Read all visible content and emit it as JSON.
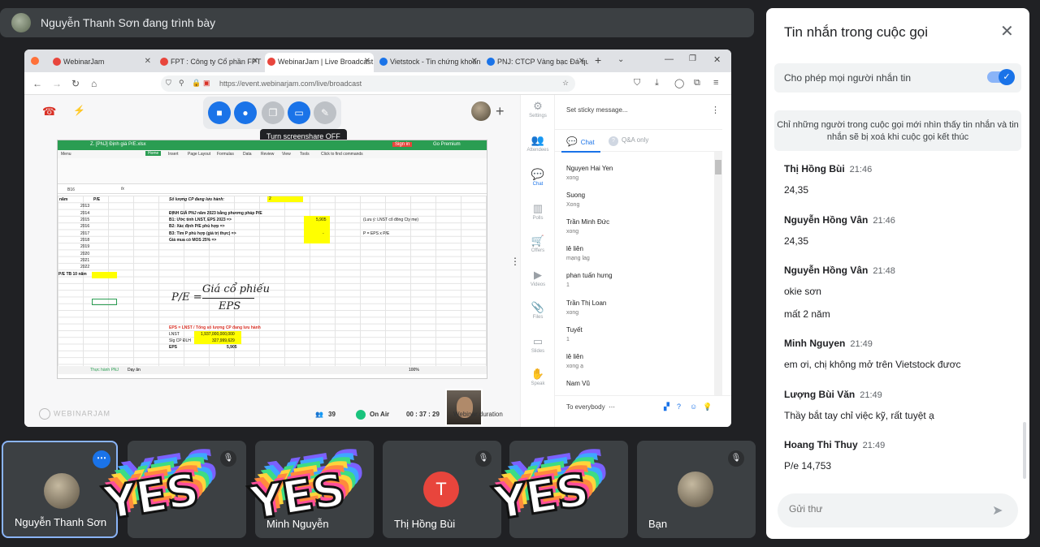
{
  "presenter_bar": {
    "text": "Nguyễn Thanh Sơn đang trình bày"
  },
  "browser": {
    "tabs": [
      {
        "label": "WebinarJam",
        "fav": "#e8453c"
      },
      {
        "label": "FPT : Công ty Cổ phần FPT",
        "fav": "#e8453c"
      },
      {
        "label": "WebinarJam | Live Broadcast",
        "fav": "#e8453c"
      },
      {
        "label": "Vietstock - Tin chứng khoán",
        "fav": "#1a73e8"
      },
      {
        "label": "PNJ: CTCP Vàng bạc Đá quý",
        "fav": "#1a73e8"
      }
    ],
    "url": "https://event.webinarjam.com/live/broadcast"
  },
  "webinar": {
    "tooltip": "Turn screenshare OFF",
    "sticky_placeholder": "Set sticky message...",
    "tab_chat": "Chat",
    "tab_qa": "Q&A only",
    "sidebar": [
      {
        "label": "Settings",
        "icon": "gear-icon",
        "glyph": "⚙"
      },
      {
        "label": "Attendees",
        "icon": "people-icon",
        "glyph": "👥"
      },
      {
        "label": "Chat",
        "icon": "chat-icon",
        "glyph": "💬"
      },
      {
        "label": "Polls",
        "icon": "poll-icon",
        "glyph": "▥"
      },
      {
        "label": "Offers",
        "icon": "cart-icon",
        "glyph": "🛒"
      },
      {
        "label": "Videos",
        "icon": "video-icon",
        "glyph": "▶"
      },
      {
        "label": "Files",
        "icon": "clip-icon",
        "glyph": "📎"
      },
      {
        "label": "Slides",
        "icon": "slides-icon",
        "glyph": "▭"
      },
      {
        "label": "Speak",
        "icon": "hand-icon",
        "glyph": "✋"
      }
    ],
    "chat": [
      {
        "name": "Nguyen Hai Yen",
        "text": "xong"
      },
      {
        "name": "Suong",
        "text": "Xong"
      },
      {
        "name": "Trần Minh Đức",
        "text": "xong"
      },
      {
        "name": "lê liên",
        "text": "mạng lag"
      },
      {
        "name": "phan tuấn hưng",
        "text": "1"
      },
      {
        "name": "Trần Thị Loan",
        "text": "xong"
      },
      {
        "name": "Tuyết",
        "text": "1"
      },
      {
        "name": "lê liên",
        "text": "xong ạ"
      },
      {
        "name": "Nam Vũ",
        "text": ""
      }
    ],
    "to_everybody": "To everybody",
    "attendees": "39",
    "on_air": "On Air",
    "timer": "00 : 37 : 29",
    "duration_label": "Webinar duration",
    "logo": "WEBINARJAM"
  },
  "spreadsheet": {
    "file": "Z. [PNJ] Định giá P/E.xlsx",
    "premium": "Go Premium",
    "signin": "Sign in",
    "menu": [
      "Menu",
      "Home",
      "Insert",
      "Page Layout",
      "Formulas",
      "Data",
      "Review",
      "View",
      "Tools",
      "Click to find commands"
    ],
    "cellref": "B16",
    "header_year": "năm",
    "header_pe": "P/E",
    "years": [
      "2013",
      "2014",
      "2015",
      "2016",
      "2017",
      "2018",
      "2019",
      "2020",
      "2021",
      "2022"
    ],
    "pe_avg_label": "P/E TB 10 năm",
    "shares_label": "Số lượng CP đang lưu hành:",
    "method_title": "ĐỊNH GIÁ PNJ năm 2023 bằng phương pháp P/E",
    "steps": [
      "B1: Ước tính LNST, EPS 2023 =>",
      "B2: Xác định P/E phù hợp =>",
      "B3: Tìm P phù hợp (giá trị thực) =>",
      "Giá mua có MOS 25% =>"
    ],
    "note1": "(Lưu ý: LNST cổ đông Cty mẹ)",
    "note2": "P = EPS x P/E",
    "eps_value": "5,905",
    "dash": "-",
    "formula_lhs": "P/E =",
    "formula_num": "Giá cổ phiếu",
    "formula_den": "EPS",
    "eps_formula": "EPS = LNST / Tổng số lượng CP đang lưu hành",
    "lnst_label": "LNST",
    "lnst_value": "1,937,000,000,000",
    "shares_row_label": "Slg CP ĐLH",
    "shares_value": "327,999,629",
    "eps_label": "EPS",
    "sheet_tab1": "Thực hành PNJ",
    "sheet_tab2": "Dạy ăn",
    "zoom": "100%"
  },
  "panel": {
    "title": "Tin nhắn trong cuộc gọi",
    "allow_label": "Cho phép mọi người nhắn tin",
    "allow_on": true,
    "notice": "Chỉ những người trong cuộc gọi mới nhìn thấy tin nhắn và tin nhắn sẽ bị xoá khi cuộc gọi kết thúc",
    "messages": [
      {
        "name": "Thị Hồng Bùi",
        "time": "21:46",
        "lines": [
          "24,35"
        ]
      },
      {
        "name": "Nguyễn Hồng Vân",
        "time": "21:46",
        "lines": [
          "24,35"
        ]
      },
      {
        "name": "Nguyễn Hồng Vân",
        "time": "21:48",
        "lines": [
          "okie sơn",
          "mất 2 năm"
        ]
      },
      {
        "name": "Minh Nguyen",
        "time": "21:49",
        "lines": [
          "em ơi, chị không mở trên Vietstock đươc"
        ]
      },
      {
        "name": "Lượng Bùi Văn",
        "time": "21:49",
        "lines": [
          "Thầy bắt tay chỉ việc kỹ, rất tuyệt ạ"
        ]
      },
      {
        "name": "Hoang Thi Thuy",
        "time": "21:49",
        "lines": [
          "P/e 14,753"
        ]
      }
    ],
    "input_placeholder": "Gửi thư"
  },
  "tiles": [
    {
      "name": "Nguyễn Thanh Sơn"
    },
    {
      "name": ""
    },
    {
      "name": "Minh Nguyễn"
    },
    {
      "name": "Thị Hồng Bùi",
      "initial": "T",
      "color": "#e8453c"
    },
    {
      "name": ""
    },
    {
      "name": "Bạn"
    }
  ],
  "sticker": {
    "text": "YES",
    "colors": [
      "#7b61ff",
      "#3fa7ff",
      "#3ddc84",
      "#ffd43b",
      "#ff8a3d",
      "#ff4f9a"
    ]
  }
}
